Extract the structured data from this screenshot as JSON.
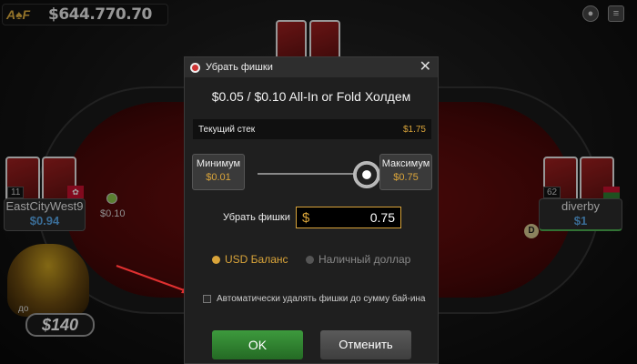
{
  "colors": {
    "accent_gold": "#d9a43a",
    "ok_green": "#2e7d32",
    "felt_red": "#6b0d0d",
    "stack_blue": "#5aa8e8",
    "arrow_red": "#e03030"
  },
  "top_bar": {
    "logo": "A♠F",
    "balance": "$644.770.70",
    "icons": [
      "chip-icon",
      "menu-icon"
    ]
  },
  "seats": [
    {
      "name": "EastCityWest9",
      "stack": "$0.94",
      "level": "11",
      "flag": "flag-icon"
    },
    {
      "name": "diverby",
      "stack": "$1",
      "level": "62",
      "flag": "flag-icon"
    }
  ],
  "table": {
    "bet_chip": "$0.10",
    "dealer": "D"
  },
  "jackpot": {
    "prefix": "до",
    "amount": "$140"
  },
  "dialog": {
    "title": "Убрать фишки",
    "game": "$0.05 / $0.10 All-In or Fold Холдем",
    "current_stack_label": "Текущий стек",
    "current_stack_value": "$1.75",
    "min_label": "Минимум",
    "min_value": "$0.01",
    "max_label": "Максимум",
    "max_value": "$0.75",
    "slider_fraction": 1.0,
    "remove_label": "Убрать фишки",
    "currency": "$",
    "remove_value": "0.75",
    "radio_usd": "USD Баланс",
    "radio_cash": "Наличный доллар",
    "radio_selected": "usd",
    "auto_remove_label": "Автоматически удалять фишки до сумму бай-ина",
    "auto_remove_checked": false,
    "ok_label": "OK",
    "cancel_label": "Отменить"
  }
}
